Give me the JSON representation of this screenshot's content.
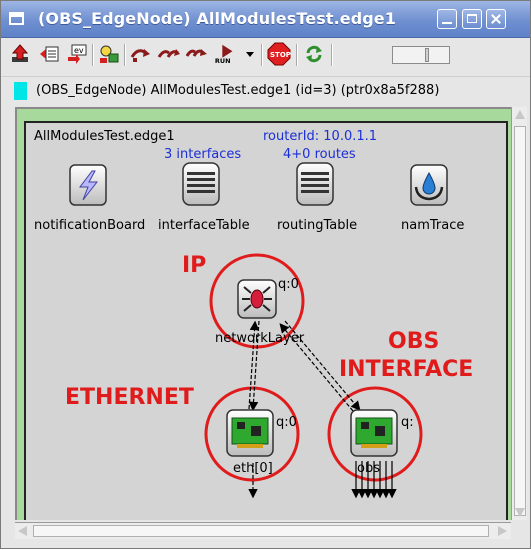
{
  "window": {
    "title": "(OBS_EdgeNode) AllModulesTest.edge1"
  },
  "toolbar": {
    "buttons": [
      {
        "name": "parent-module-button",
        "icon": "up-arrow-icon"
      },
      {
        "name": "module-output-button",
        "icon": "module-output-icon"
      },
      {
        "name": "event-log-button",
        "icon": "ev-icon"
      },
      {
        "name": "find-objects-button",
        "icon": "inspect-icon"
      },
      {
        "name": "step-button",
        "icon": "step-icon"
      },
      {
        "name": "fast-run-button",
        "icon": "fast-run-icon"
      },
      {
        "name": "run-button",
        "icon": "run-icon",
        "label": "RUN"
      },
      {
        "name": "run-mode-dropdown",
        "icon": "chevron-down-icon"
      },
      {
        "name": "stop-button",
        "icon": "stop-icon",
        "label": "STOP"
      },
      {
        "name": "refresh-button",
        "icon": "refresh-icon"
      }
    ]
  },
  "infobar": {
    "text": "(OBS_EdgeNode) AllModulesTest.edge1  (id=3)  (ptr0x8a5f288)",
    "swatch_color": "#00e6e6"
  },
  "canvas": {
    "module_title": "AllModulesTest.edge1",
    "router_id": "routerId: 10.0.1.1",
    "interfaces_count": "3 interfaces",
    "routes_count": "4+0 routes",
    "submodules": [
      {
        "name": "notificationBoard",
        "icon": "lightning-icon"
      },
      {
        "name": "interfaceTable",
        "icon": "table-icon"
      },
      {
        "name": "routingTable",
        "icon": "table-icon"
      },
      {
        "name": "namTrace",
        "icon": "drop-icon"
      },
      {
        "name": "networkLayer",
        "icon": "router-icon",
        "queue": "q:0"
      },
      {
        "name": "eth[0]",
        "icon": "nic-icon",
        "queue": "q:0"
      },
      {
        "name": "obs",
        "icon": "nic-icon",
        "queue": "q:"
      }
    ],
    "annotations": {
      "ip": "IP",
      "ethernet": "ETHERNET",
      "obs_line1": "OBS",
      "obs_line2": "INTERFACE"
    }
  },
  "colors": {
    "titlebar": "#6f8fd0",
    "canvas_bg": "#a6d99b",
    "module_bg": "#d4d4d4",
    "annotation_red": "#e01b1b",
    "info_blue": "#1b2fd6"
  }
}
